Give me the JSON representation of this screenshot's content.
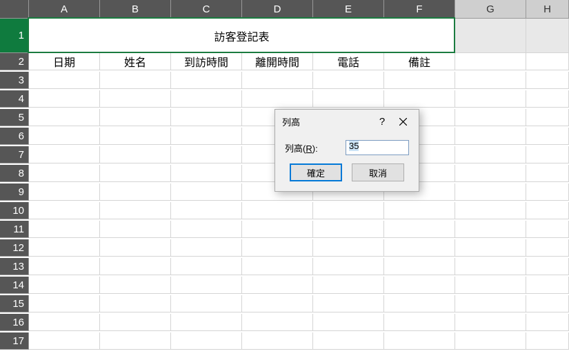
{
  "columns": [
    "A",
    "B",
    "C",
    "D",
    "E",
    "F",
    "G",
    "H"
  ],
  "rows_visible": [
    "1",
    "2",
    "3",
    "4",
    "5",
    "6",
    "7",
    "8",
    "9",
    "10",
    "11",
    "12",
    "13",
    "14",
    "15",
    "16",
    "17"
  ],
  "title_row_cell": "訪客登記表",
  "header_row": {
    "A": "日期",
    "B": "姓名",
    "C": "到訪時間",
    "D": "離開時間",
    "E": "電話",
    "F": "備註"
  },
  "selected_row": "1",
  "dialog": {
    "title": "列高",
    "help_symbol": "?",
    "label_prefix": "列高(",
    "label_hotkey": "R",
    "label_suffix": "):",
    "value": "35",
    "ok": "確定",
    "cancel": "取消"
  }
}
